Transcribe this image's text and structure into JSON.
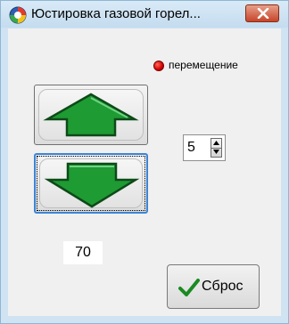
{
  "window": {
    "title": "Юстировка газовой горел...",
    "close_icon": "close-icon",
    "app_icon": "app-icon"
  },
  "indicator": {
    "label": "перемещение",
    "color": "#d40000"
  },
  "controls": {
    "up_icon": "arrow-up-icon",
    "down_icon": "arrow-down-icon",
    "arrow_color": "#1e9b33",
    "step_value": "5",
    "readout_value": "70",
    "reset_label": "Сброс",
    "reset_icon": "checkmark-icon"
  }
}
